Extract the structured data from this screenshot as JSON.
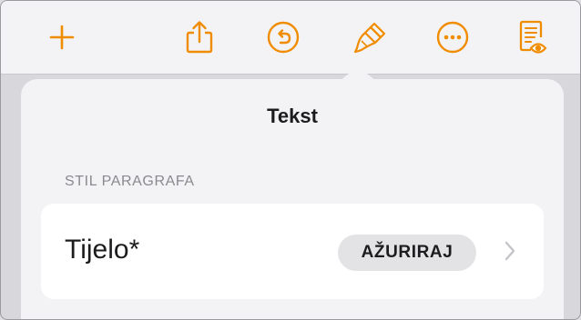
{
  "toolbar": {
    "accent_color": "#f08c00",
    "icons": [
      "add-icon",
      "share-icon",
      "undo-icon",
      "format-brush-icon",
      "more-icon",
      "reading-view-icon"
    ]
  },
  "popover": {
    "title": "Tekst",
    "section_label": "STIL PARAGRAFA",
    "style_row": {
      "label": "Tijelo*",
      "update_button_label": "AŽURIRAJ",
      "chevron_icon": "chevron-right-icon"
    }
  }
}
